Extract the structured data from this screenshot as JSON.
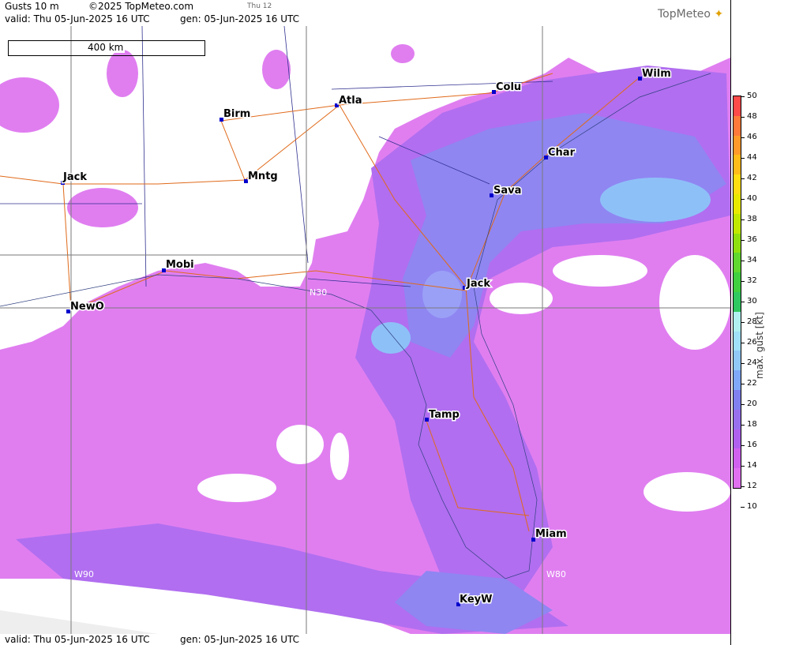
{
  "header": {
    "product": "Gusts 10 m",
    "copyright": "©2025 TopMeteo.com",
    "day_tag": "Thu 12",
    "valid_label": "valid:  Thu  05-Jun-2025  16 UTC",
    "gen_label": "gen: 05-Jun-2025 16 UTC"
  },
  "footer": {
    "valid_label": "valid:  Thu  05-Jun-2025  16 UTC",
    "gen_label": "gen: 05-Jun-2025 16 UTC"
  },
  "brand": {
    "name": "TopMeteo"
  },
  "scale_bar": {
    "label": "400 km"
  },
  "cities": [
    {
      "name": "Atla"
    },
    {
      "name": "Birm"
    },
    {
      "name": "Colu"
    },
    {
      "name": "Wilm"
    },
    {
      "name": "Char"
    },
    {
      "name": "Sava"
    },
    {
      "name": "Jack"
    },
    {
      "name": "Mntg"
    },
    {
      "name": "Mobi"
    },
    {
      "name": "NewO"
    },
    {
      "name": "Jack"
    },
    {
      "name": "Tamp"
    },
    {
      "name": "Miam"
    },
    {
      "name": "KeyW"
    }
  ],
  "grid_labels": {
    "n30": "N30",
    "w90": "W90",
    "w80": "W80"
  },
  "legend": {
    "title": "max. gust [kt]",
    "ticks": [
      "50",
      "48",
      "46",
      "44",
      "42",
      "40",
      "38",
      "36",
      "34",
      "32",
      "30",
      "28",
      "26",
      "24",
      "22",
      "20",
      "18",
      "16",
      "14",
      "12",
      "10"
    ],
    "colors": [
      "#ff4a4a",
      "#ff7a3a",
      "#ff9a2a",
      "#ffbb1a",
      "#ffdd10",
      "#e8e800",
      "#c0e800",
      "#90e010",
      "#60d830",
      "#40d040",
      "#30c860",
      "#b0f0f0",
      "#a0e0f8",
      "#90c8f8",
      "#80a8f8",
      "#8080f0",
      "#9870ee",
      "#b060ee",
      "#d060ee",
      "#e070f0"
    ]
  }
}
